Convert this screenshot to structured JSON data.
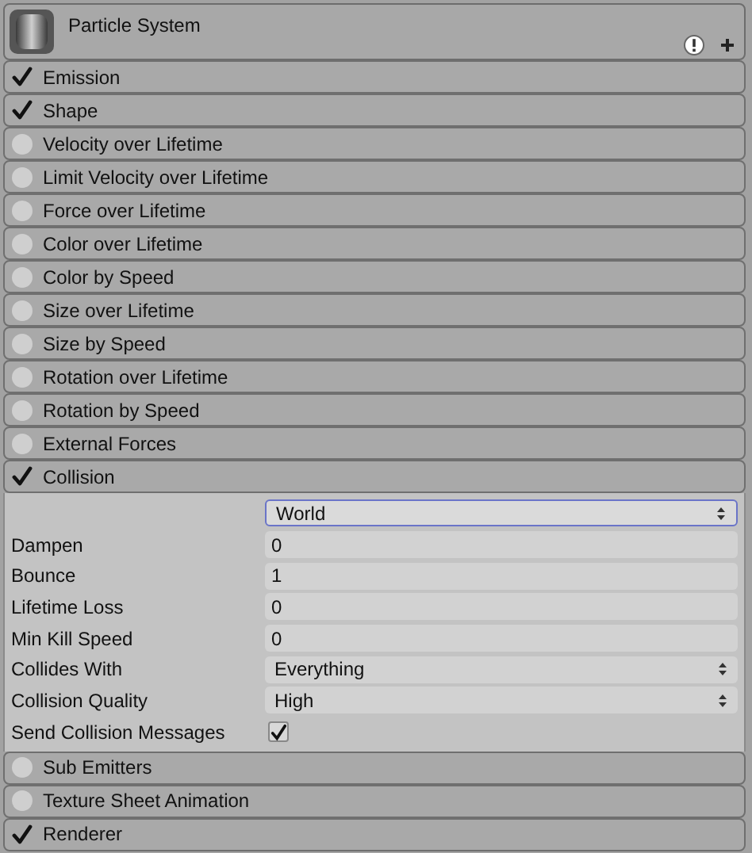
{
  "header": {
    "title": "Particle System"
  },
  "modules": [
    {
      "label": "Emission",
      "enabled": true
    },
    {
      "label": "Shape",
      "enabled": true
    },
    {
      "label": "Velocity over Lifetime",
      "enabled": false
    },
    {
      "label": "Limit Velocity over Lifetime",
      "enabled": false
    },
    {
      "label": "Force over Lifetime",
      "enabled": false
    },
    {
      "label": "Color over Lifetime",
      "enabled": false
    },
    {
      "label": "Color by Speed",
      "enabled": false
    },
    {
      "label": "Size over Lifetime",
      "enabled": false
    },
    {
      "label": "Size by Speed",
      "enabled": false
    },
    {
      "label": "Rotation over Lifetime",
      "enabled": false
    },
    {
      "label": "Rotation by Speed",
      "enabled": false
    },
    {
      "label": "External Forces",
      "enabled": false
    },
    {
      "label": "Collision",
      "enabled": true,
      "fields": [
        {
          "kind": "dropdown",
          "value": "World",
          "focused": true
        },
        {
          "kind": "number",
          "label": "Dampen",
          "value": "0"
        },
        {
          "kind": "number",
          "label": "Bounce",
          "value": "1"
        },
        {
          "kind": "number",
          "label": "Lifetime Loss",
          "value": "0"
        },
        {
          "kind": "number",
          "label": "Min Kill Speed",
          "value": "0"
        },
        {
          "kind": "dropdown",
          "label": "Collides With",
          "value": "Everything",
          "focused": false
        },
        {
          "kind": "dropdown",
          "label": "Collision Quality",
          "value": "High",
          "focused": false
        },
        {
          "kind": "checkbox",
          "label": "Send Collision Messages",
          "checked": true
        }
      ]
    },
    {
      "label": "Sub Emitters",
      "enabled": false
    },
    {
      "label": "Texture Sheet Animation",
      "enabled": false
    },
    {
      "label": "Renderer",
      "enabled": true
    }
  ]
}
